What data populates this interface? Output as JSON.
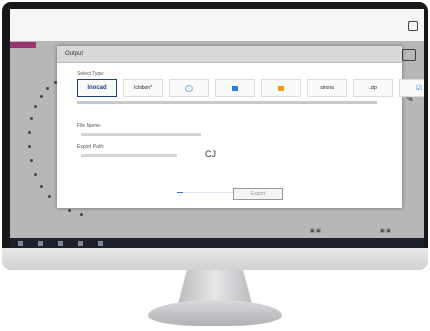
{
  "dialog": {
    "title": "Output",
    "select_type_label": "Select Type:",
    "types": [
      {
        "label": "Inocad",
        "selected": true
      },
      {
        "label": "Ichibon*",
        "selected": false
      },
      {
        "label": "",
        "selected": false,
        "icon": "circle-icon"
      },
      {
        "label": "",
        "selected": false,
        "icon": "folder-icon"
      },
      {
        "label": "",
        "selected": false,
        "icon": "orange-square-icon"
      },
      {
        "label": "sirona",
        "selected": false
      },
      {
        "label": ".zip",
        "selected": false
      },
      {
        "label": "",
        "selected": false,
        "icon": "check-icon"
      }
    ],
    "file_label": "File Name:",
    "path_label": "Export Path:",
    "center_text": "CJ",
    "ok_label": "Export",
    "progress": 0.1
  },
  "colors": {
    "accent": "#c4267f",
    "brand_blue": "#1a3f8f"
  }
}
